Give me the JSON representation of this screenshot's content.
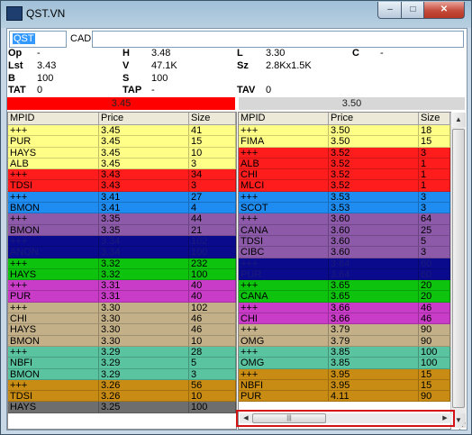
{
  "window": {
    "title": "QST.VN",
    "min": "–",
    "max": "□",
    "close": "✕"
  },
  "symbol": {
    "value": "QST",
    "exchange": "CAD",
    "description": ""
  },
  "quote": {
    "op_label": "Op",
    "op": "-",
    "h_label": "H",
    "h": "3.48",
    "l_label": "L",
    "l": "3.30",
    "c_label": "C",
    "c": "-",
    "lst_label": "Lst",
    "lst": "3.43",
    "v_label": "V",
    "v": "47.1K",
    "sz_label": "Sz",
    "sz": "2.8Kx1.5K",
    "b_label": "B",
    "b": "100",
    "s_label": "S",
    "s": "100",
    "tat_label": "TAT",
    "tat": "0",
    "tap_label": "TAP",
    "tap": "-",
    "tav_label": "TAV",
    "tav": "0"
  },
  "bid_header": "3.45",
  "ask_header": "3.50",
  "columns": [
    "MPID",
    "Price",
    "Size"
  ],
  "colors": {
    "yellow": "#ffff88",
    "red": "#ff1c1c",
    "blue": "#1e8cf0",
    "purple": "#8c5aa8",
    "navy": "#0a0a8c",
    "green": "#0ec30e",
    "magenta": "#c83cc8",
    "tan": "#c3b088",
    "teal": "#5ac3a0",
    "orange": "#c88c14",
    "gray": "#6e6e6e"
  },
  "bids": [
    {
      "mpid": "+++",
      "price": "3.45",
      "size": "41",
      "color": "yellow"
    },
    {
      "mpid": "PUR",
      "price": "3.45",
      "size": "15",
      "color": "yellow"
    },
    {
      "mpid": "HAYS",
      "price": "3.45",
      "size": "10",
      "color": "yellow"
    },
    {
      "mpid": "ALB",
      "price": "3.45",
      "size": "3",
      "color": "yellow"
    },
    {
      "mpid": "+++",
      "price": "3.43",
      "size": "34",
      "color": "red"
    },
    {
      "mpid": "TDSI",
      "price": "3.43",
      "size": "3",
      "color": "red"
    },
    {
      "mpid": "+++",
      "price": "3.41",
      "size": "27",
      "color": "blue"
    },
    {
      "mpid": "BMON",
      "price": "3.41",
      "size": "4",
      "color": "blue"
    },
    {
      "mpid": "+++",
      "price": "3.35",
      "size": "44",
      "color": "purple"
    },
    {
      "mpid": "BMON",
      "price": "3.35",
      "size": "21",
      "color": "purple"
    },
    {
      "mpid": "+++",
      "price": "3.34",
      "size": "102",
      "color": "navy"
    },
    {
      "mpid": "ANON",
      "price": "3.34",
      "size": "100",
      "color": "navy"
    },
    {
      "mpid": "+++",
      "price": "3.32",
      "size": "232",
      "color": "green"
    },
    {
      "mpid": "HAYS",
      "price": "3.32",
      "size": "100",
      "color": "green"
    },
    {
      "mpid": "+++",
      "price": "3.31",
      "size": "40",
      "color": "magenta"
    },
    {
      "mpid": "PUR",
      "price": "3.31",
      "size": "40",
      "color": "magenta"
    },
    {
      "mpid": "+++",
      "price": "3.30",
      "size": "102",
      "color": "tan"
    },
    {
      "mpid": "CHI",
      "price": "3.30",
      "size": "46",
      "color": "tan"
    },
    {
      "mpid": "HAYS",
      "price": "3.30",
      "size": "46",
      "color": "tan"
    },
    {
      "mpid": "BMON",
      "price": "3.30",
      "size": "10",
      "color": "tan"
    },
    {
      "mpid": "+++",
      "price": "3.29",
      "size": "28",
      "color": "teal"
    },
    {
      "mpid": "NBFI",
      "price": "3.29",
      "size": "5",
      "color": "teal"
    },
    {
      "mpid": "BMON",
      "price": "3.29",
      "size": "3",
      "color": "teal"
    },
    {
      "mpid": "+++",
      "price": "3.26",
      "size": "56",
      "color": "orange"
    },
    {
      "mpid": "TDSI",
      "price": "3.26",
      "size": "10",
      "color": "orange"
    },
    {
      "mpid": "HAYS",
      "price": "3.25",
      "size": "100",
      "color": "gray"
    }
  ],
  "asks": [
    {
      "mpid": "+++",
      "price": "3.50",
      "size": "18",
      "color": "yellow"
    },
    {
      "mpid": "FIMA",
      "price": "3.50",
      "size": "15",
      "color": "yellow"
    },
    {
      "mpid": "+++",
      "price": "3.52",
      "size": "3",
      "color": "red"
    },
    {
      "mpid": "ALB",
      "price": "3.52",
      "size": "1",
      "color": "red"
    },
    {
      "mpid": "CHI",
      "price": "3.52",
      "size": "1",
      "color": "red"
    },
    {
      "mpid": "MLCI",
      "price": "3.52",
      "size": "1",
      "color": "red"
    },
    {
      "mpid": "+++",
      "price": "3.53",
      "size": "3",
      "color": "blue"
    },
    {
      "mpid": "SCOT",
      "price": "3.53",
      "size": "3",
      "color": "blue"
    },
    {
      "mpid": "+++",
      "price": "3.60",
      "size": "64",
      "color": "purple"
    },
    {
      "mpid": "CANA",
      "price": "3.60",
      "size": "25",
      "color": "purple"
    },
    {
      "mpid": "TDSI",
      "price": "3.60",
      "size": "5",
      "color": "purple"
    },
    {
      "mpid": "CIBC",
      "price": "3.60",
      "size": "3",
      "color": "purple"
    },
    {
      "mpid": "+++",
      "price": "3.64",
      "size": "60",
      "color": "navy"
    },
    {
      "mpid": "PUR",
      "price": "3.64",
      "size": "60",
      "color": "navy"
    },
    {
      "mpid": "+++",
      "price": "3.65",
      "size": "20",
      "color": "green"
    },
    {
      "mpid": "CANA",
      "price": "3.65",
      "size": "20",
      "color": "green"
    },
    {
      "mpid": "+++",
      "price": "3.66",
      "size": "46",
      "color": "magenta"
    },
    {
      "mpid": "CHI",
      "price": "3.66",
      "size": "46",
      "color": "magenta"
    },
    {
      "mpid": "+++",
      "price": "3.79",
      "size": "90",
      "color": "tan"
    },
    {
      "mpid": "OMG",
      "price": "3.79",
      "size": "90",
      "color": "tan"
    },
    {
      "mpid": "+++",
      "price": "3.85",
      "size": "100",
      "color": "teal"
    },
    {
      "mpid": "OMG",
      "price": "3.85",
      "size": "100",
      "color": "teal"
    },
    {
      "mpid": "+++",
      "price": "3.95",
      "size": "15",
      "color": "orange"
    },
    {
      "mpid": "NBFI",
      "price": "3.95",
      "size": "15",
      "color": "orange"
    },
    {
      "mpid": "PUR",
      "price": "4.11",
      "size": "90",
      "color": "orange"
    }
  ]
}
